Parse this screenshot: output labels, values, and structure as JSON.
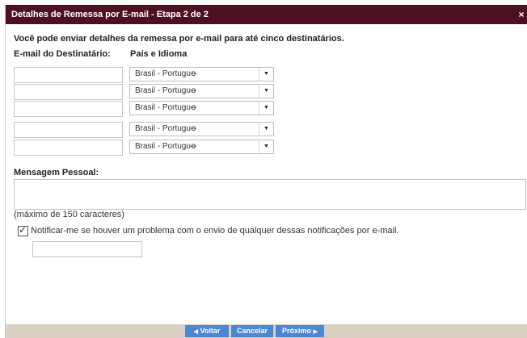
{
  "dialog": {
    "title": "Detalhes de Remessa por E-mail - Etapa 2 de 2",
    "close_glyph": "×",
    "intro": "Você pode enviar detalhes da remessa por e-mail para até cinco destinatários.",
    "col_email": "E-mail do Destinatário:",
    "col_country": "País e Idioma",
    "recipients": [
      {
        "email": "",
        "country": "Brasil - Portuguꝋ"
      },
      {
        "email": "",
        "country": "Brasil - Portuguꝋ"
      },
      {
        "email": "",
        "country": "Brasil - Portuguꝋ"
      },
      {
        "email": "",
        "country": "Brasil - Portuguꝋ"
      },
      {
        "email": "",
        "country": "Brasil - Portuguꝋ"
      }
    ],
    "message_label": "Mensagem Pessoal:",
    "message_value": "",
    "max_chars": "(máximo de 150 caracteres)",
    "notify_checked": true,
    "notify_label": "Notificar-me se houver um problema com o envio de qualquer dessas notificações por e-mail.",
    "notify_email": ""
  },
  "footer": {
    "back_label": "Voltar",
    "cancel_label": "Cancelar",
    "next_label": "Próximo",
    "back_arrow": "◀",
    "next_arrow": "▶"
  },
  "colors": {
    "titlebar": "#4d1020",
    "button": "#4a88d6",
    "footer": "#d9cfc3"
  },
  "icons": {
    "close": "close-icon",
    "dropdown": "chevron-down-icon",
    "check": "checkmark-icon"
  }
}
